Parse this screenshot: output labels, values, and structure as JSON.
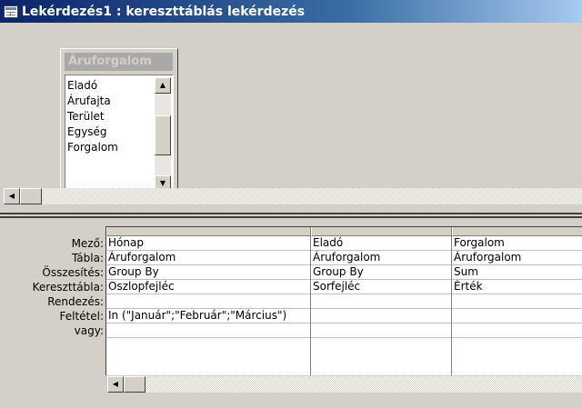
{
  "window": {
    "title": "Lekérdezés1 : kereszttáblás lekérdezés"
  },
  "field_list": {
    "title": "Áruforgalom",
    "fields": [
      "Eladó",
      "Árufajta",
      "Terület",
      "Egység",
      "Forgalom"
    ]
  },
  "design_grid": {
    "row_labels": [
      "Mező:",
      "Tábla:",
      "Összesítés:",
      "Kereszttábla:",
      "Rendezés:",
      "Feltétel:",
      "vagy:"
    ],
    "columns": [
      {
        "cells": [
          "Hónap",
          "Áruforgalom",
          "Group By",
          "Oszlopfejléc",
          "",
          "In (\"Január\";\"Február\";\"Március\")",
          ""
        ]
      },
      {
        "cells": [
          "Eladó",
          "Áruforgalom",
          "Group By",
          "Sorfejléc",
          "",
          "",
          ""
        ]
      },
      {
        "cells": [
          "Forgalom",
          "Áruforgalom",
          "Sum",
          "Érték",
          "",
          "",
          ""
        ]
      }
    ]
  },
  "icons": {
    "window": "query-window-icon",
    "scroll_up": "arrow-up-icon",
    "scroll_down": "arrow-down-icon",
    "scroll_left": "arrow-left-icon"
  }
}
